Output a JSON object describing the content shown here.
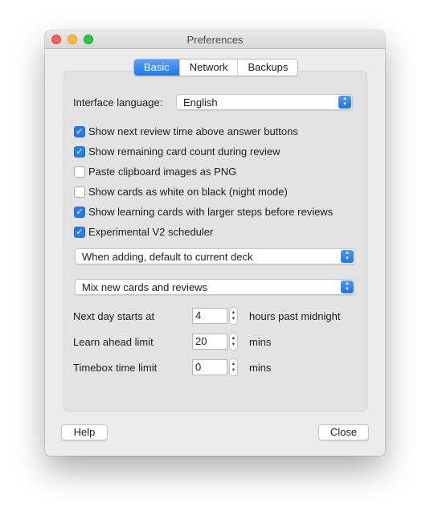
{
  "window": {
    "title": "Preferences"
  },
  "tabs": [
    {
      "label": "Basic",
      "active": true
    },
    {
      "label": "Network",
      "active": false
    },
    {
      "label": "Backups",
      "active": false
    }
  ],
  "interface_language": {
    "label": "Interface language:",
    "value": "English"
  },
  "checkboxes": [
    {
      "label": "Show next review time above answer buttons",
      "checked": true
    },
    {
      "label": "Show remaining card count during review",
      "checked": true
    },
    {
      "label": "Paste clipboard images as PNG",
      "checked": false
    },
    {
      "label": "Show cards as white on black (night mode)",
      "checked": false
    },
    {
      "label": "Show learning cards with larger steps before reviews",
      "checked": true
    },
    {
      "label": "Experimental V2 scheduler",
      "checked": true
    }
  ],
  "deck_default": {
    "value": "When adding, default to current deck"
  },
  "card_mix": {
    "value": "Mix new cards and reviews"
  },
  "spinners": [
    {
      "label": "Next day starts at",
      "value": "4",
      "suffix": "hours past midnight"
    },
    {
      "label": "Learn ahead limit",
      "value": "20",
      "suffix": "mins"
    },
    {
      "label": "Timebox time limit",
      "value": "0",
      "suffix": "mins"
    }
  ],
  "buttons": {
    "help": "Help",
    "close": "Close"
  },
  "colors": {
    "accent": "#2a7de9",
    "close_light": "#fe5f57",
    "minimize_light": "#febc2e",
    "zoom_light": "#28c840"
  },
  "icons": {
    "checkmark": "✓",
    "up": "▲",
    "down": "▼"
  }
}
